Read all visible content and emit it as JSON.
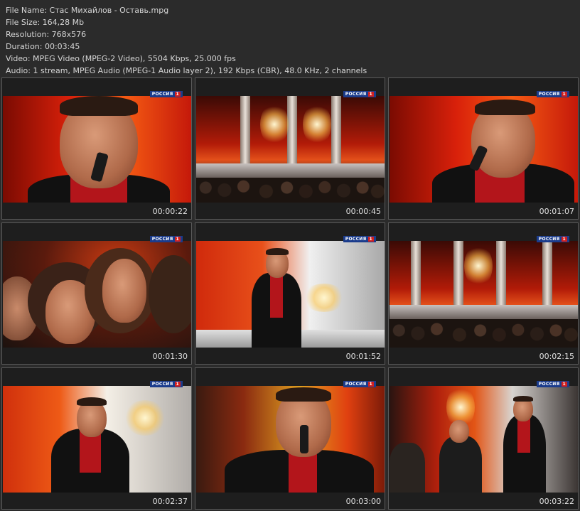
{
  "info": {
    "file_name": "File Name: Стас Михайлов - Оставь.mpg",
    "file_size": "File Size: 164,28 Mb",
    "resolution": "Resolution: 768x576",
    "duration": "Duration: 00:03:45",
    "video": "Video: MPEG Video (MPEG-2 Video), 5504 Kbps, 25.000 fps",
    "audio": "Audio: 1 stream, MPEG Audio (MPEG-1 Audio layer 2), 192 Kbps (CBR), 48.0 KHz, 2 channels"
  },
  "logo_text": "РОССИЯ",
  "logo_number": "1",
  "thumbnails": [
    {
      "time": "00:00:22"
    },
    {
      "time": "00:00:45"
    },
    {
      "time": "00:01:07"
    },
    {
      "time": "00:01:30"
    },
    {
      "time": "00:01:52"
    },
    {
      "time": "00:02:15"
    },
    {
      "time": "00:02:37"
    },
    {
      "time": "00:03:00"
    },
    {
      "time": "00:03:22"
    }
  ]
}
